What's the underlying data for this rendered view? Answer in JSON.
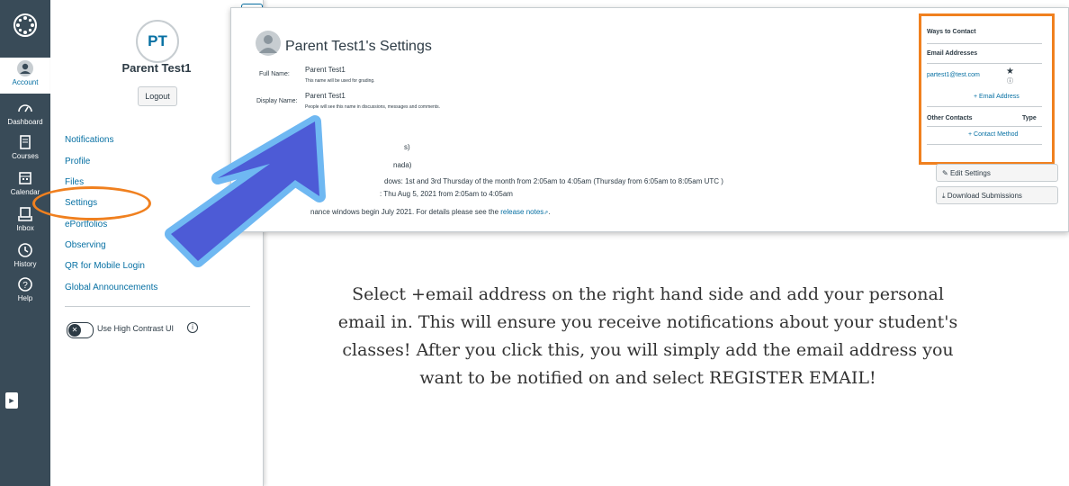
{
  "rail": {
    "items": [
      {
        "label": "Account"
      },
      {
        "label": "Dashboard"
      },
      {
        "label": "Courses"
      },
      {
        "label": "Calendar"
      },
      {
        "label": "Inbox"
      },
      {
        "label": "History"
      },
      {
        "label": "Help"
      }
    ]
  },
  "tray": {
    "initials": "PT",
    "name": "Parent Test1",
    "logout": "Logout",
    "links": [
      {
        "label": "Notifications"
      },
      {
        "label": "Profile"
      },
      {
        "label": "Files"
      },
      {
        "label": "Settings"
      },
      {
        "label": "ePortfolios"
      },
      {
        "label": "Observing"
      },
      {
        "label": "QR for Mobile Login"
      },
      {
        "label": "Global Announcements"
      }
    ],
    "high_contrast_label": "Use High Contrast UI"
  },
  "settings": {
    "title": "Parent Test1's Settings",
    "full_name_label": "Full Name:",
    "full_name_value": "Parent Test1",
    "full_name_hint": "This name will be used for grading.",
    "display_name_label": "Display Name:",
    "display_name_value": "Parent Test1",
    "display_name_hint": "People will see this name in discussions, messages and comments.",
    "partial_1": "s)",
    "partial_2": "nada)",
    "maintenance_window": "dows: 1st and 3rd Thursday of the month from 2:05am to 4:05am (Thursday from 6:05am to 8:05am UTC )",
    "next_window": ": Thu Aug 5, 2021 from 2:05am to 4:05am",
    "notice_prefix": "nance windows begin July 2021. For details please see the",
    "release_notes": "release notes",
    "notice_suffix": "."
  },
  "contact": {
    "heading": "Ways to Contact",
    "email_heading": "Email Addresses",
    "email": "partest1@test.com",
    "add_email": "+ Email Address",
    "other_heading": "Other Contacts",
    "type_heading": "Type",
    "add_contact": "+ Contact Method"
  },
  "buttons": {
    "edit_settings": "Edit Settings",
    "download_submissions": "Download Submissions"
  },
  "instruction": "Select +email address on the right hand side and add your personal email in. This will ensure you receive notifications about your student's classes! After you click this, you will simply add the email address you want to be notified on and select REGISTER EMAIL!",
  "colors": {
    "rail": "#394b58",
    "link": "#0770a3",
    "highlight": "#f0801f",
    "arrow_fill": "#4d5bd6",
    "arrow_stroke": "#6fb8f2"
  }
}
